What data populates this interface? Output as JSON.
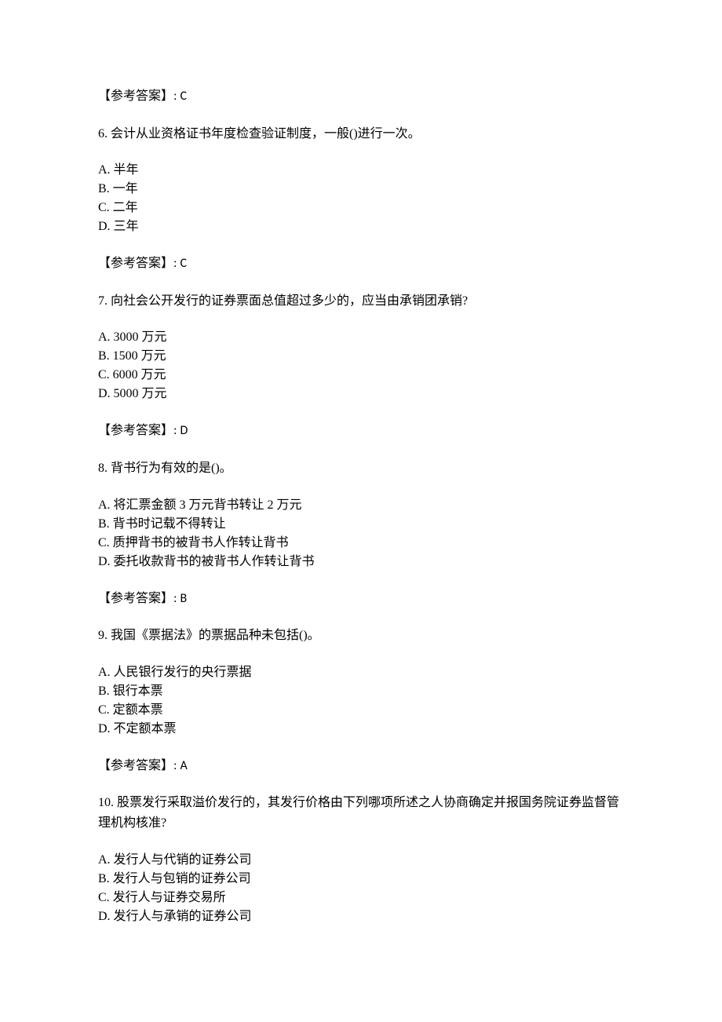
{
  "answer_label": "【参考答案】: ",
  "items": [
    {
      "answer_only": true,
      "answer": "C"
    },
    {
      "stem": "6. 会计从业资格证书年度检查验证制度，一般()进行一次。",
      "options": [
        "A. 半年",
        "B. 一年",
        "C. 二年",
        "D. 三年"
      ],
      "answer": "C"
    },
    {
      "stem": "7. 向社会公开发行的证券票面总值超过多少的，应当由承销团承销?",
      "options": [
        "A. 3000 万元",
        "B. 1500 万元",
        "C. 6000 万元",
        "D. 5000 万元"
      ],
      "answer": "D"
    },
    {
      "stem": "8. 背书行为有效的是()。",
      "options": [
        "A. 将汇票金额 3 万元背书转让 2 万元",
        "B. 背书时记载不得转让",
        "C. 质押背书的被背书人作转让背书",
        "D. 委托收款背书的被背书人作转让背书"
      ],
      "answer": "B"
    },
    {
      "stem": "9. 我国《票据法》的票据品种未包括()。",
      "options": [
        "A. 人民银行发行的央行票据",
        "B. 银行本票",
        "C. 定额本票",
        "D. 不定额本票"
      ],
      "answer": "A"
    },
    {
      "stem": "10. 股票发行采取溢价发行的，其发行价格由下列哪项所述之人协商确定并报国务院证券监督管理机构核准?",
      "options": [
        "A. 发行人与代销的证券公司",
        "B. 发行人与包销的证券公司",
        "C. 发行人与证券交易所",
        "D. 发行人与承销的证券公司"
      ]
    }
  ]
}
